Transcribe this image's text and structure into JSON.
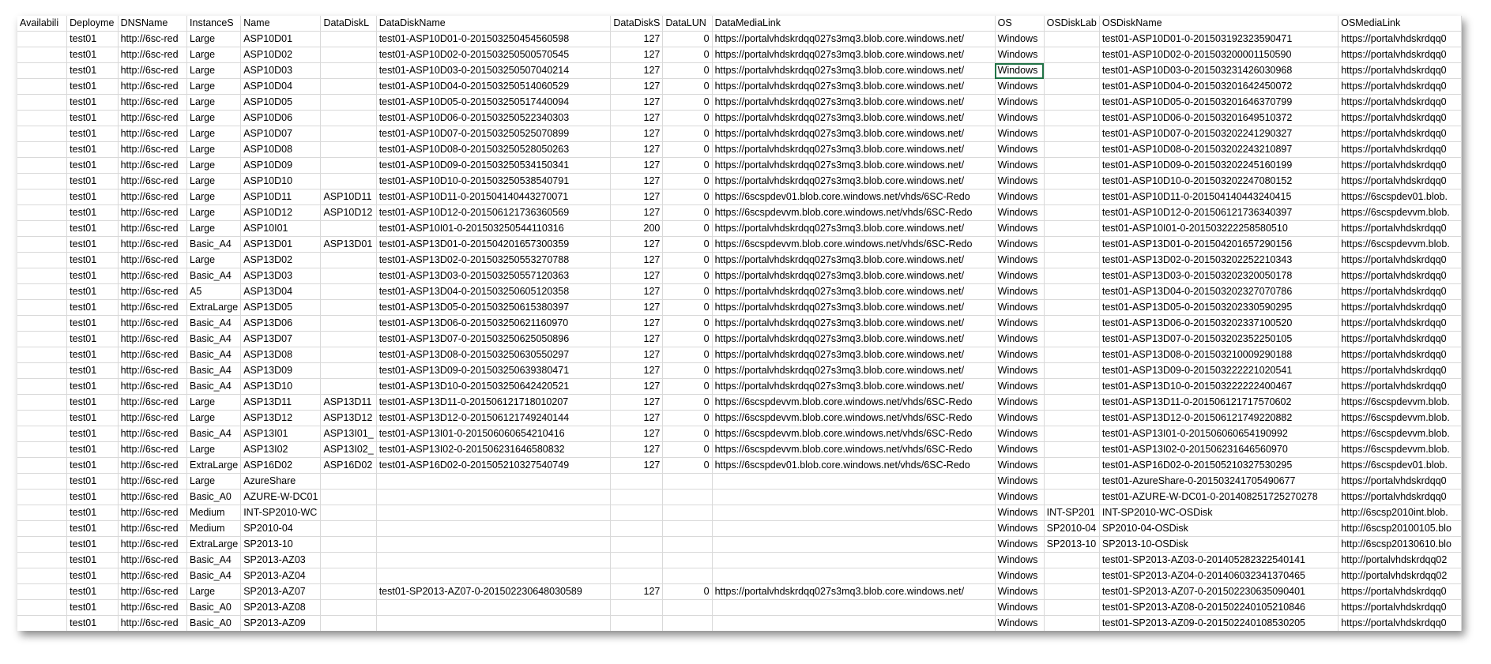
{
  "columns": [
    "Availabili",
    "Deployme",
    "DNSName",
    "InstanceS",
    "Name",
    "DataDiskL",
    "DataDiskName",
    "DataDiskS",
    "DataLUN",
    "DataMediaLink",
    "OS",
    "OSDiskLab",
    "OSDiskName",
    "OSMediaLink"
  ],
  "rows": [
    [
      "",
      "test01",
      "http://6sc-red",
      "Large",
      "ASP10D01",
      "",
      "test01-ASP10D01-0-201503250454560598",
      "127",
      "0",
      "https://portalvhdskrdqq027s3mq3.blob.core.windows.net/",
      "Windows",
      "",
      "test01-ASP10D01-0-201503192323590471",
      "https://portalvhdskrdqq0"
    ],
    [
      "",
      "test01",
      "http://6sc-red",
      "Large",
      "ASP10D02",
      "",
      "test01-ASP10D02-0-201503250500570545",
      "127",
      "0",
      "https://portalvhdskrdqq027s3mq3.blob.core.windows.net/",
      "Windows",
      "",
      "test01-ASP10D02-0-201503200001150590",
      "https://portalvhdskrdqq0"
    ],
    [
      "",
      "test01",
      "http://6sc-red",
      "Large",
      "ASP10D03",
      "",
      "test01-ASP10D03-0-201503250507040214",
      "127",
      "0",
      "https://portalvhdskrdqq027s3mq3.blob.core.windows.net/",
      "Windows",
      "",
      "test01-ASP10D03-0-201503231426030968",
      "https://portalvhdskrdqq0"
    ],
    [
      "",
      "test01",
      "http://6sc-red",
      "Large",
      "ASP10D04",
      "",
      "test01-ASP10D04-0-201503250514060529",
      "127",
      "0",
      "https://portalvhdskrdqq027s3mq3.blob.core.windows.net/",
      "Windows",
      "",
      "test01-ASP10D04-0-201503201642450072",
      "https://portalvhdskrdqq0"
    ],
    [
      "",
      "test01",
      "http://6sc-red",
      "Large",
      "ASP10D05",
      "",
      "test01-ASP10D05-0-201503250517440094",
      "127",
      "0",
      "https://portalvhdskrdqq027s3mq3.blob.core.windows.net/",
      "Windows",
      "",
      "test01-ASP10D05-0-201503201646370799",
      "https://portalvhdskrdqq0"
    ],
    [
      "",
      "test01",
      "http://6sc-red",
      "Large",
      "ASP10D06",
      "",
      "test01-ASP10D06-0-201503250522340303",
      "127",
      "0",
      "https://portalvhdskrdqq027s3mq3.blob.core.windows.net/",
      "Windows",
      "",
      "test01-ASP10D06-0-201503201649510372",
      "https://portalvhdskrdqq0"
    ],
    [
      "",
      "test01",
      "http://6sc-red",
      "Large",
      "ASP10D07",
      "",
      "test01-ASP10D07-0-201503250525070899",
      "127",
      "0",
      "https://portalvhdskrdqq027s3mq3.blob.core.windows.net/",
      "Windows",
      "",
      "test01-ASP10D07-0-201503202241290327",
      "https://portalvhdskrdqq0"
    ],
    [
      "",
      "test01",
      "http://6sc-red",
      "Large",
      "ASP10D08",
      "",
      "test01-ASP10D08-0-201503250528050263",
      "127",
      "0",
      "https://portalvhdskrdqq027s3mq3.blob.core.windows.net/",
      "Windows",
      "",
      "test01-ASP10D08-0-201503202243210897",
      "https://portalvhdskrdqq0"
    ],
    [
      "",
      "test01",
      "http://6sc-red",
      "Large",
      "ASP10D09",
      "",
      "test01-ASP10D09-0-201503250534150341",
      "127",
      "0",
      "https://portalvhdskrdqq027s3mq3.blob.core.windows.net/",
      "Windows",
      "",
      "test01-ASP10D09-0-201503202245160199",
      "https://portalvhdskrdqq0"
    ],
    [
      "",
      "test01",
      "http://6sc-red",
      "Large",
      "ASP10D10",
      "",
      "test01-ASP10D10-0-201503250538540791",
      "127",
      "0",
      "https://portalvhdskrdqq027s3mq3.blob.core.windows.net/",
      "Windows",
      "",
      "test01-ASP10D10-0-201503202247080152",
      "https://portalvhdskrdqq0"
    ],
    [
      "",
      "test01",
      "http://6sc-red",
      "Large",
      "ASP10D11",
      "ASP10D11",
      "test01-ASP10D11-0-201504140443270071",
      "127",
      "0",
      "https://6scspdev01.blob.core.windows.net/vhds/6SC-Redo",
      "Windows",
      "",
      "test01-ASP10D11-0-201504140443240415",
      "https://6scspdev01.blob."
    ],
    [
      "",
      "test01",
      "http://6sc-red",
      "Large",
      "ASP10D12",
      "ASP10D12",
      "test01-ASP10D12-0-201506121736360569",
      "127",
      "0",
      "https://6scspdevvm.blob.core.windows.net/vhds/6SC-Redo",
      "Windows",
      "",
      "test01-ASP10D12-0-201506121736340397",
      "https://6scspdevvm.blob."
    ],
    [
      "",
      "test01",
      "http://6sc-red",
      "Large",
      "ASP10I01",
      "",
      "test01-ASP10I01-0-201503250544110316",
      "200",
      "0",
      "https://portalvhdskrdqq027s3mq3.blob.core.windows.net/",
      "Windows",
      "",
      "test01-ASP10I01-0-201503222258580510",
      "https://portalvhdskrdqq0"
    ],
    [
      "",
      "test01",
      "http://6sc-red",
      "Basic_A4",
      "ASP13D01",
      "ASP13D01",
      "test01-ASP13D01-0-201504201657300359",
      "127",
      "0",
      "https://6scspdevvm.blob.core.windows.net/vhds/6SC-Redo",
      "Windows",
      "",
      "test01-ASP13D01-0-201504201657290156",
      "https://6scspdevvm.blob."
    ],
    [
      "",
      "test01",
      "http://6sc-red",
      "Large",
      "ASP13D02",
      "",
      "test01-ASP13D02-0-201503250553270788",
      "127",
      "0",
      "https://portalvhdskrdqq027s3mq3.blob.core.windows.net/",
      "Windows",
      "",
      "test01-ASP13D02-0-201503202252210343",
      "https://portalvhdskrdqq0"
    ],
    [
      "",
      "test01",
      "http://6sc-red",
      "Basic_A4",
      "ASP13D03",
      "",
      "test01-ASP13D03-0-201503250557120363",
      "127",
      "0",
      "https://portalvhdskrdqq027s3mq3.blob.core.windows.net/",
      "Windows",
      "",
      "test01-ASP13D03-0-201503202320050178",
      "https://portalvhdskrdqq0"
    ],
    [
      "",
      "test01",
      "http://6sc-red",
      "A5",
      "ASP13D04",
      "",
      "test01-ASP13D04-0-201503250605120358",
      "127",
      "0",
      "https://portalvhdskrdqq027s3mq3.blob.core.windows.net/",
      "Windows",
      "",
      "test01-ASP13D04-0-201503202327070786",
      "https://portalvhdskrdqq0"
    ],
    [
      "",
      "test01",
      "http://6sc-red",
      "ExtraLarge",
      "ASP13D05",
      "",
      "test01-ASP13D05-0-201503250615380397",
      "127",
      "0",
      "https://portalvhdskrdqq027s3mq3.blob.core.windows.net/",
      "Windows",
      "",
      "test01-ASP13D05-0-201503202330590295",
      "https://portalvhdskrdqq0"
    ],
    [
      "",
      "test01",
      "http://6sc-red",
      "Basic_A4",
      "ASP13D06",
      "",
      "test01-ASP13D06-0-201503250621160970",
      "127",
      "0",
      "https://portalvhdskrdqq027s3mq3.blob.core.windows.net/",
      "Windows",
      "",
      "test01-ASP13D06-0-201503202337100520",
      "https://portalvhdskrdqq0"
    ],
    [
      "",
      "test01",
      "http://6sc-red",
      "Basic_A4",
      "ASP13D07",
      "",
      "test01-ASP13D07-0-201503250625050896",
      "127",
      "0",
      "https://portalvhdskrdqq027s3mq3.blob.core.windows.net/",
      "Windows",
      "",
      "test01-ASP13D07-0-201503202352250105",
      "https://portalvhdskrdqq0"
    ],
    [
      "",
      "test01",
      "http://6sc-red",
      "Basic_A4",
      "ASP13D08",
      "",
      "test01-ASP13D08-0-201503250630550297",
      "127",
      "0",
      "https://portalvhdskrdqq027s3mq3.blob.core.windows.net/",
      "Windows",
      "",
      "test01-ASP13D08-0-201503210009290188",
      "https://portalvhdskrdqq0"
    ],
    [
      "",
      "test01",
      "http://6sc-red",
      "Basic_A4",
      "ASP13D09",
      "",
      "test01-ASP13D09-0-201503250639380471",
      "127",
      "0",
      "https://portalvhdskrdqq027s3mq3.blob.core.windows.net/",
      "Windows",
      "",
      "test01-ASP13D09-0-201503222221020541",
      "https://portalvhdskrdqq0"
    ],
    [
      "",
      "test01",
      "http://6sc-red",
      "Basic_A4",
      "ASP13D10",
      "",
      "test01-ASP13D10-0-201503250642420521",
      "127",
      "0",
      "https://portalvhdskrdqq027s3mq3.blob.core.windows.net/",
      "Windows",
      "",
      "test01-ASP13D10-0-201503222222400467",
      "https://portalvhdskrdqq0"
    ],
    [
      "",
      "test01",
      "http://6sc-red",
      "Large",
      "ASP13D11",
      "ASP13D11",
      "test01-ASP13D11-0-201506121718010207",
      "127",
      "0",
      "https://6scspdevvm.blob.core.windows.net/vhds/6SC-Redo",
      "Windows",
      "",
      "test01-ASP13D11-0-201506121717570602",
      "https://6scspdevvm.blob."
    ],
    [
      "",
      "test01",
      "http://6sc-red",
      "Large",
      "ASP13D12",
      "ASP13D12",
      "test01-ASP13D12-0-201506121749240144",
      "127",
      "0",
      "https://6scspdevvm.blob.core.windows.net/vhds/6SC-Redo",
      "Windows",
      "",
      "test01-ASP13D12-0-201506121749220882",
      "https://6scspdevvm.blob."
    ],
    [
      "",
      "test01",
      "http://6sc-red",
      "Basic_A4",
      "ASP13I01",
      "ASP13I01_",
      "test01-ASP13I01-0-201506060654210416",
      "127",
      "0",
      "https://6scspdevvm.blob.core.windows.net/vhds/6SC-Redo",
      "Windows",
      "",
      "test01-ASP13I01-0-201506060654190992",
      "https://6scspdevvm.blob."
    ],
    [
      "",
      "test01",
      "http://6sc-red",
      "Large",
      "ASP13I02",
      "ASP13I02_",
      "test01-ASP13I02-0-201506231646580832",
      "127",
      "0",
      "https://6scspdevvm.blob.core.windows.net/vhds/6SC-Redo",
      "Windows",
      "",
      "test01-ASP13I02-0-201506231646560970",
      "https://6scspdevvm.blob."
    ],
    [
      "",
      "test01",
      "http://6sc-red",
      "ExtraLarge",
      "ASP16D02",
      "ASP16D02",
      "test01-ASP16D02-0-201505210327540749",
      "127",
      "0",
      "https://6scspdev01.blob.core.windows.net/vhds/6SC-Redo",
      "Windows",
      "",
      "test01-ASP16D02-0-201505210327530295",
      "https://6scspdev01.blob."
    ],
    [
      "",
      "test01",
      "http://6sc-red",
      "Large",
      "AzureShare",
      "",
      "",
      "",
      "",
      "",
      "Windows",
      "",
      "test01-AzureShare-0-201503241705490677",
      "https://portalvhdskrdqq0"
    ],
    [
      "",
      "test01",
      "http://6sc-red",
      "Basic_A0",
      "AZURE-W-DC01",
      "",
      "",
      "",
      "",
      "",
      "Windows",
      "",
      "test01-AZURE-W-DC01-0-201408251725270278",
      "https://portalvhdskrdqq0"
    ],
    [
      "",
      "test01",
      "http://6sc-red",
      "Medium",
      "INT-SP2010-WC",
      "",
      "",
      "",
      "",
      "",
      "Windows",
      "INT-SP201",
      "INT-SP2010-WC-OSDisk",
      "http://6scsp2010int.blob."
    ],
    [
      "",
      "test01",
      "http://6sc-red",
      "Medium",
      "SP2010-04",
      "",
      "",
      "",
      "",
      "",
      "Windows",
      "SP2010-04",
      "SP2010-04-OSDisk",
      "http://6scsp20100105.blo"
    ],
    [
      "",
      "test01",
      "http://6sc-red",
      "ExtraLarge",
      "SP2013-10",
      "",
      "",
      "",
      "",
      "",
      "Windows",
      "SP2013-10",
      "SP2013-10-OSDisk",
      "http://6scsp20130610.blo"
    ],
    [
      "",
      "test01",
      "http://6sc-red",
      "Basic_A4",
      "SP2013-AZ03",
      "",
      "",
      "",
      "",
      "",
      "Windows",
      "",
      "test01-SP2013-AZ03-0-201405282322540141",
      "http://portalvhdskrdqq02"
    ],
    [
      "",
      "test01",
      "http://6sc-red",
      "Basic_A4",
      "SP2013-AZ04",
      "",
      "",
      "",
      "",
      "",
      "Windows",
      "",
      "test01-SP2013-AZ04-0-201406032341370465",
      "http://portalvhdskrdqq02"
    ],
    [
      "",
      "test01",
      "http://6sc-red",
      "Large",
      "SP2013-AZ07",
      "",
      "test01-SP2013-AZ07-0-201502230648030589",
      "127",
      "0",
      "https://portalvhdskrdqq027s3mq3.blob.core.windows.net/",
      "Windows",
      "",
      "test01-SP2013-AZ07-0-201502230635090401",
      "https://portalvhdskrdqq0"
    ],
    [
      "",
      "test01",
      "http://6sc-red",
      "Basic_A0",
      "SP2013-AZ08",
      "",
      "",
      "",
      "",
      "",
      "Windows",
      "",
      "test01-SP2013-AZ08-0-201502240105210846",
      "https://portalvhdskrdqq0"
    ],
    [
      "",
      "test01",
      "http://6sc-red",
      "Basic_A0",
      "SP2013-AZ09",
      "",
      "",
      "",
      "",
      "",
      "Windows",
      "",
      "test01-SP2013-AZ09-0-201502240108530205",
      "https://portalvhdskrdqq0"
    ]
  ]
}
